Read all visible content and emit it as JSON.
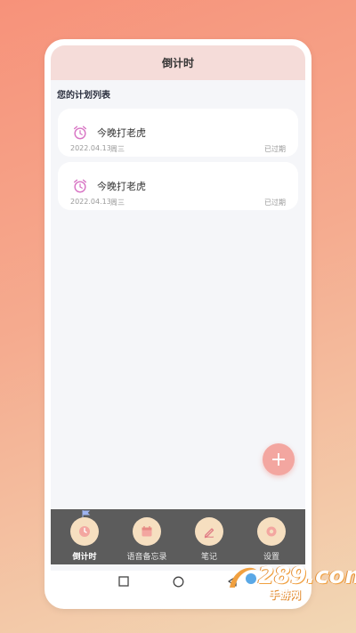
{
  "header": {
    "title": "倒计时"
  },
  "section": {
    "title": "您的计划列表"
  },
  "plans": [
    {
      "name": "今晚打老虎",
      "date": "2022.04.13",
      "weekday": "周三",
      "status": "已过期"
    },
    {
      "name": "今晚打老虎",
      "date": "2022.04.13",
      "weekday": "周三",
      "status": "已过期"
    }
  ],
  "fab": {
    "label": "+"
  },
  "tabs": [
    {
      "label": "倒计时",
      "icon": "clock-icon"
    },
    {
      "label": "语音备忘录",
      "icon": "calendar-icon"
    },
    {
      "label": "笔记",
      "icon": "pen-icon"
    },
    {
      "label": "设置",
      "icon": "gear-icon"
    }
  ],
  "watermark": {
    "text": "289.com",
    "sub": "手游网"
  },
  "colors": {
    "titlebar": "#f5dcd9",
    "tabbar": "#5c5c5c",
    "tab_icon_bg": "#f6dfc0",
    "fab": "#f3a6a0",
    "alarm_icon": "#d874c4"
  }
}
